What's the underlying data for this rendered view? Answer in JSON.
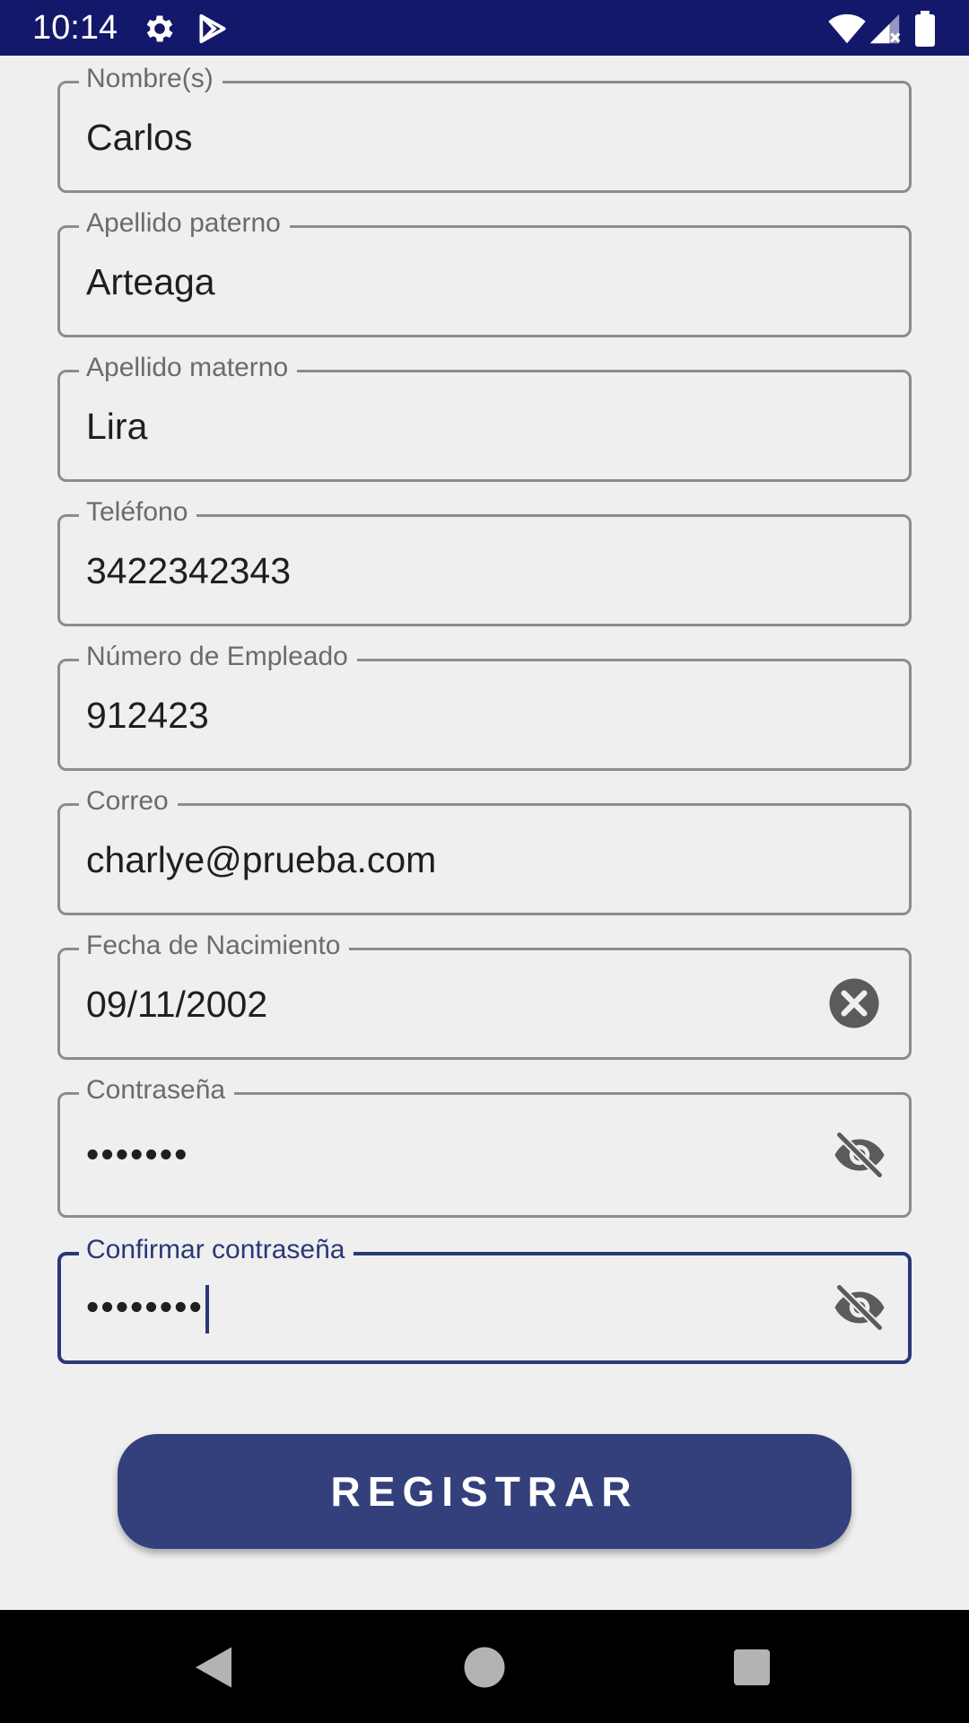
{
  "status_bar": {
    "time": "10:14",
    "icons": [
      "settings-icon",
      "play-store-icon",
      "wifi-icon",
      "cell-signal-icon",
      "battery-icon"
    ]
  },
  "form": {
    "fields": [
      {
        "label": "Nombre(s)",
        "value": "Carlos"
      },
      {
        "label": "Apellido paterno",
        "value": "Arteaga"
      },
      {
        "label": "Apellido materno",
        "value": "Lira"
      },
      {
        "label": "Teléfono",
        "value": "3422342343"
      },
      {
        "label": "Número de Empleado",
        "value": "912423"
      },
      {
        "label": "Correo",
        "value": "charlye@prueba.com"
      },
      {
        "label": "Fecha de Nacimiento",
        "value": "09/11/2002",
        "trailing_icon": "clear-icon"
      },
      {
        "label": "Contraseña",
        "value": "•••••••",
        "trailing_icon": "visibility-off-icon"
      },
      {
        "label": "Confirmar contraseña",
        "value": "••••••••",
        "trailing_icon": "visibility-off-icon",
        "focused": true
      }
    ]
  },
  "register_button": {
    "label": "REGISTRAR"
  },
  "colors": {
    "status_bar": "#13186a",
    "primary": "#33407c",
    "focus": "#2a3778",
    "background": "#efefef",
    "outline": "#8c8c8c"
  },
  "nav_bar": {
    "buttons": [
      "back-icon",
      "home-icon",
      "recents-icon"
    ]
  }
}
